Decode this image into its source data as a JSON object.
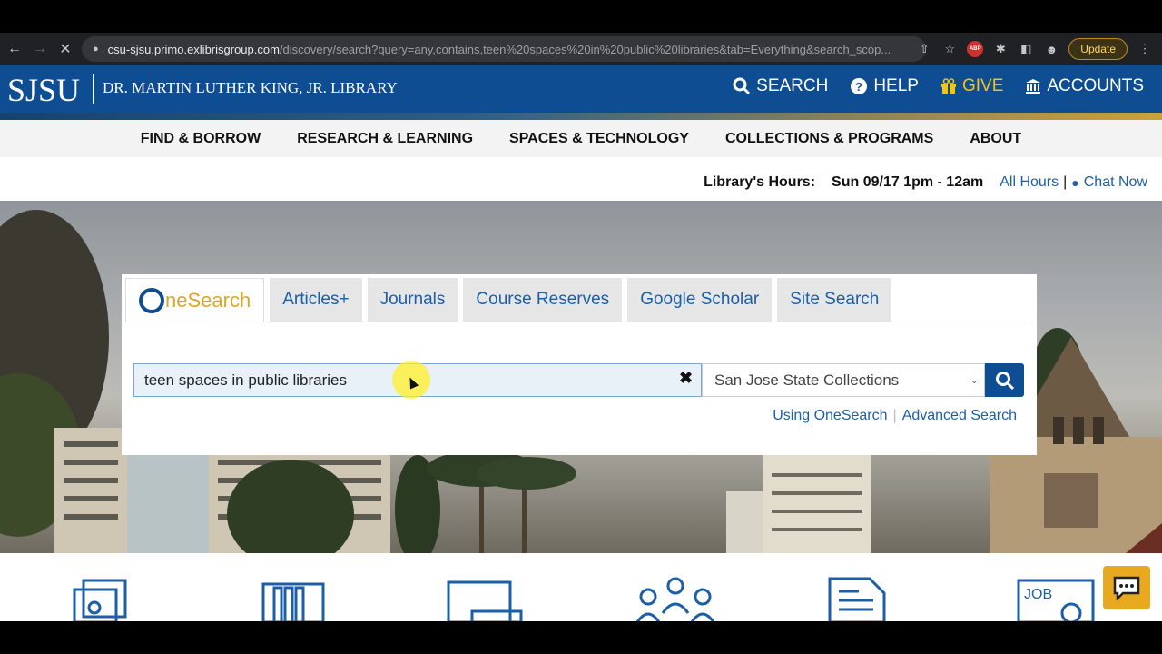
{
  "browser": {
    "url_host": "csu-sjsu.primo.exlibrisgroup.com",
    "url_path": "/discovery/search?query=any,contains,teen%20spaces%20in%20public%20libraries&tab=Everything&search_scop...",
    "update_label": "Update",
    "extension_badge": "ABP"
  },
  "header": {
    "logo": "SJSU",
    "library_name": "DR. MARTIN LUTHER KING, JR. LIBRARY",
    "nav": [
      "SEARCH",
      "HELP",
      "GIVE",
      "ACCOUNTS"
    ]
  },
  "main_nav": [
    "FIND & BORROW",
    "RESEARCH & LEARNING",
    "SPACES & TECHNOLOGY",
    "COLLECTIONS & PROGRAMS",
    "ABOUT"
  ],
  "hours": {
    "label": "Library's Hours:",
    "value": "Sun 09/17 1pm - 12am",
    "all_hours": "All Hours",
    "separator": "|",
    "chat": "Chat Now"
  },
  "search": {
    "tabs": [
      "Articles+",
      "Journals",
      "Course Reserves",
      "Google Scholar",
      "Site Search"
    ],
    "onesearch_tab": {
      "o": "O",
      "rest": "neSearch"
    },
    "query": "teen spaces in public libraries",
    "scope": "San Jose State Collections",
    "links": [
      "Using OneSearch",
      "Advanced Search"
    ],
    "links_sep": "|"
  },
  "services_icons": [
    "printer-icon",
    "books-icon",
    "laptop-icon",
    "group-icon",
    "document-icon",
    "job-board-icon"
  ],
  "colors": {
    "brand_blue": "#0e4d92",
    "gold": "#f0c419",
    "link_blue": "#1d5fa6"
  }
}
